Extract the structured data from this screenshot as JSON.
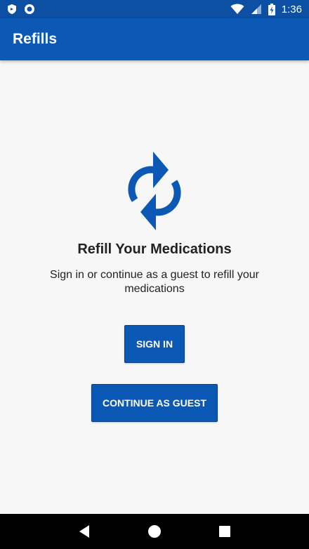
{
  "status_bar": {
    "time": "1:36",
    "left_icons": [
      "shield-icon",
      "circle-notification-icon"
    ],
    "right_icons": [
      "wifi-icon",
      "cell-signal-icon",
      "battery-charging-icon"
    ]
  },
  "app_bar": {
    "title": "Refills"
  },
  "main": {
    "icon": "refresh-arrows-icon",
    "heading": "Refill Your Medications",
    "subtitle": "Sign in or continue as a guest to refill your medications",
    "sign_in_label": "SIGN IN",
    "guest_label": "CONTINUE AS GUEST"
  },
  "nav_bar": {
    "buttons": [
      "back-icon",
      "home-icon",
      "recents-icon"
    ]
  },
  "colors": {
    "primary": "#0c58b5",
    "status_bar": "#0d4fa3",
    "background": "#f7f7f7"
  }
}
